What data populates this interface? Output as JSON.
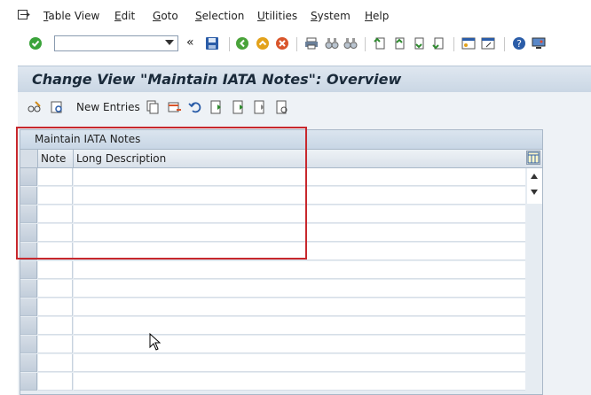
{
  "menubar": {
    "items": [
      {
        "label": "Table View"
      },
      {
        "label": "Edit"
      },
      {
        "label": "Goto"
      },
      {
        "label": "Selection"
      },
      {
        "label": "Utilities"
      },
      {
        "label": "System"
      },
      {
        "label": "Help"
      }
    ]
  },
  "toolbar": {
    "command_value": "",
    "nav_glyph": "«"
  },
  "title": "Change View \"Maintain IATA Notes\": Overview",
  "app_toolbar": {
    "new_entries_label": "New Entries"
  },
  "table": {
    "caption": "Maintain IATA Notes",
    "columns": [
      "Note",
      "Long Description"
    ],
    "rows": [
      "",
      "",
      "",
      "",
      "",
      "",
      "",
      "",
      "",
      "",
      "",
      "",
      ""
    ]
  },
  "colors": {
    "highlight": "#c8282d",
    "title_bar": "#c9d6e4"
  }
}
